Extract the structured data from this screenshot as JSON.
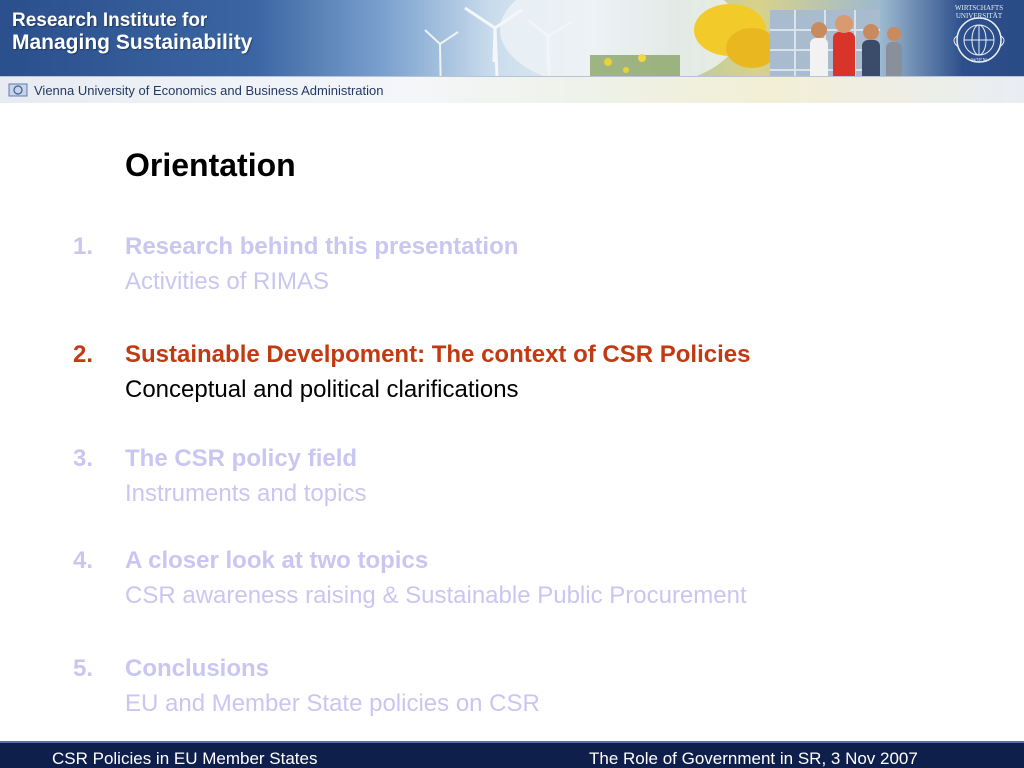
{
  "header": {
    "title_line1": "Research Institute for",
    "title_line2": "Managing Sustainability",
    "subtitle": "Vienna University of Economics and Business Administration",
    "seal_top": "WIRTSCHAFTS UNIVERSITÄT",
    "seal_bottom": "WIEN",
    "banner_icons": [
      "wind-turbine-icon",
      "wind-turbine-icon",
      "wind-turbine-icon",
      "butterfly-icon",
      "university-seal-icon"
    ]
  },
  "slide": {
    "title": "Orientation",
    "agenda": [
      {
        "number": "1.",
        "heading": "Research behind this presentation",
        "subheading": "Activities of RIMAS",
        "active": false
      },
      {
        "number": "2.",
        "heading": "Sustainable Develpoment: The context of CSR Policies",
        "subheading": "Conceptual and political clarifications",
        "active": true
      },
      {
        "number": "3.",
        "heading": "The CSR policy field",
        "subheading": "Instruments and topics",
        "active": false
      },
      {
        "number": "4.",
        "heading": "A closer look at two topics",
        "subheading": "CSR awareness raising & Sustainable Public Procurement",
        "active": false
      },
      {
        "number": "5.",
        "heading": "Conclusions",
        "subheading": "EU and Member State policies on CSR",
        "active": false
      }
    ]
  },
  "footer": {
    "left": "CSR Policies in EU Member States",
    "right": "The Role of Government in SR, 3 Nov 2007"
  },
  "colors": {
    "active": "#c23a12",
    "muted": "#c9c6f2",
    "footer_bg": "#0d1f4a",
    "header_blue": "#2a4f8c"
  }
}
